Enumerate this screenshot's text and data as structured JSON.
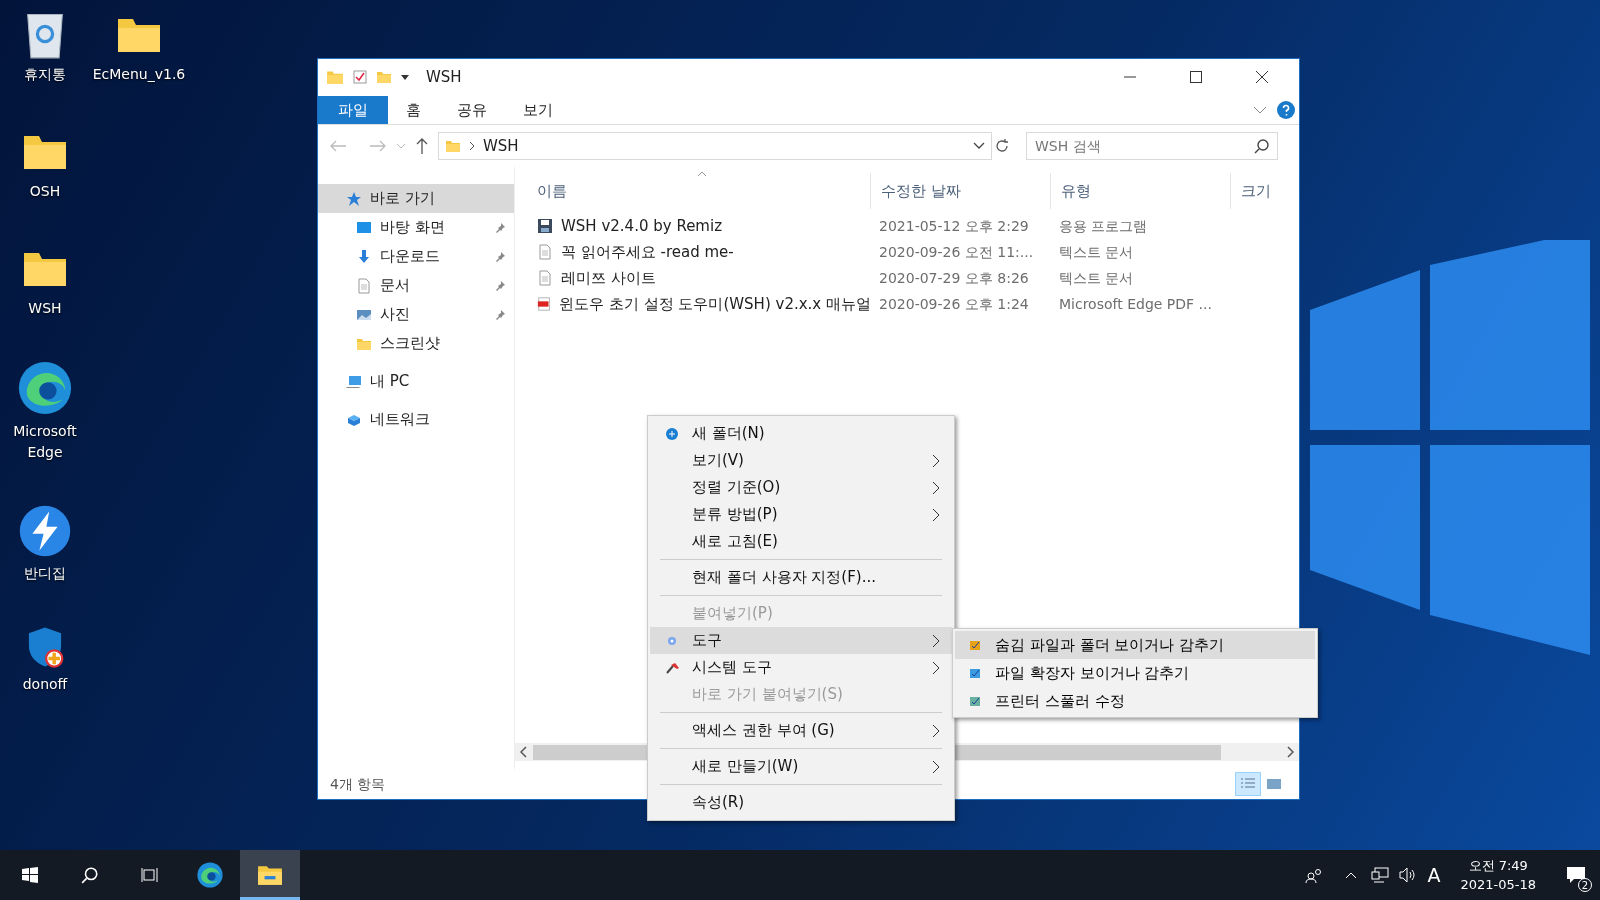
{
  "desktop_icons": [
    {
      "label": "휴지통"
    },
    {
      "label": "EcMenu_v1.6"
    },
    {
      "label": "OSH"
    },
    {
      "label": "WSH"
    },
    {
      "label": "Microsoft Edge"
    },
    {
      "label": "반디집"
    },
    {
      "label": "donoff"
    }
  ],
  "window": {
    "title": "WSH",
    "ribbon_tabs": [
      {
        "label": "파일",
        "kind": "file"
      },
      {
        "label": "홈",
        "kind": "tab"
      },
      {
        "label": "공유",
        "kind": "tab"
      },
      {
        "label": "보기",
        "kind": "tab"
      }
    ],
    "address": "WSH",
    "search": {
      "placeholder": "WSH 검색"
    },
    "sidebar": {
      "items": [
        {
          "label": "바로 가기",
          "selected": true,
          "children": [
            {
              "label": "바탕 화면",
              "pinned": true
            },
            {
              "label": "다운로드",
              "pinned": true
            },
            {
              "label": "문서",
              "pinned": true
            },
            {
              "label": "사진",
              "pinned": true
            },
            {
              "label": "스크린샷",
              "pinned": false
            }
          ]
        },
        {
          "label": "내 PC",
          "selected": false
        },
        {
          "label": "네트워크",
          "selected": false
        }
      ]
    },
    "table": {
      "columns": [
        "이름",
        "수정한 날짜",
        "유형",
        "크기"
      ],
      "rows": [
        {
          "name": "WSH v2.4.0 by Remiz",
          "date": "2021-05-12 오후 2:29",
          "type": "응용 프로그램",
          "kind": "app"
        },
        {
          "name": "꼭 읽어주세요 -read me-",
          "date": "2020-09-26 오전 11:...",
          "type": "텍스트 문서",
          "kind": "text"
        },
        {
          "name": "레미쯔 사이트",
          "date": "2020-07-29 오후 8:26",
          "type": "텍스트 문서",
          "kind": "text"
        },
        {
          "name": "윈도우 초기 설정 도우미(WSH) v2.x.x 매뉴얼",
          "date": "2020-09-26 오후 1:24",
          "type": "Microsoft Edge PDF ...",
          "kind": "pdf"
        }
      ]
    },
    "status_bar": "4개 항목",
    "view_buttons": [
      {
        "kind": "details",
        "selected": true
      },
      {
        "kind": "large",
        "selected": false
      }
    ]
  },
  "context_menu": {
    "items": [
      {
        "kind": "item",
        "label": "새 폴더(N)",
        "submenu": false,
        "disabled": false,
        "selected": false
      },
      {
        "kind": "item",
        "label": "보기(V)",
        "submenu": true,
        "disabled": false,
        "selected": false
      },
      {
        "kind": "item",
        "label": "정렬 기준(O)",
        "submenu": true,
        "disabled": false,
        "selected": false
      },
      {
        "kind": "item",
        "label": "분류 방법(P)",
        "submenu": true,
        "disabled": false,
        "selected": false
      },
      {
        "kind": "item",
        "label": "새로 고침(E)",
        "submenu": false,
        "disabled": false,
        "selected": false
      },
      {
        "kind": "separator"
      },
      {
        "kind": "item",
        "label": "현재 폴더 사용자 지정(F)...",
        "submenu": false,
        "disabled": false,
        "selected": false
      },
      {
        "kind": "separator"
      },
      {
        "kind": "item",
        "label": "붙여넣기(P)",
        "submenu": false,
        "disabled": true,
        "selected": false
      },
      {
        "kind": "item",
        "label": "도구",
        "submenu": true,
        "disabled": false,
        "selected": true
      },
      {
        "kind": "item",
        "label": "시스템 도구",
        "submenu": true,
        "disabled": false,
        "selected": false
      },
      {
        "kind": "item",
        "label": "바로 가기 붙여넣기(S)",
        "submenu": false,
        "disabled": true,
        "selected": false
      },
      {
        "kind": "separator"
      },
      {
        "kind": "item",
        "label": "액세스 권한 부여 (G)",
        "submenu": true,
        "disabled": false,
        "selected": false
      },
      {
        "kind": "separator"
      },
      {
        "kind": "item",
        "label": "새로 만들기(W)",
        "submenu": true,
        "disabled": false,
        "selected": false
      },
      {
        "kind": "separator"
      },
      {
        "kind": "item",
        "label": "속성(R)",
        "submenu": false,
        "disabled": false,
        "selected": false
      }
    ]
  },
  "submenu": {
    "items": [
      {
        "label": "숨김 파일과 폴더 보이거나 감추기",
        "selected": true
      },
      {
        "label": "파일 확장자 보이거나 감추기",
        "selected": false
      },
      {
        "label": "프린터 스풀러 수정",
        "selected": false
      }
    ]
  },
  "taskbar": {
    "apps": [
      {
        "kind": "start",
        "selected": false
      },
      {
        "kind": "search",
        "selected": false
      },
      {
        "kind": "taskview",
        "selected": false
      },
      {
        "kind": "edge",
        "selected": false
      },
      {
        "kind": "explorer",
        "selected": true
      }
    ],
    "ime": "A",
    "time": "오전 7:49",
    "date": "2021-05-18",
    "notifications": "2"
  }
}
